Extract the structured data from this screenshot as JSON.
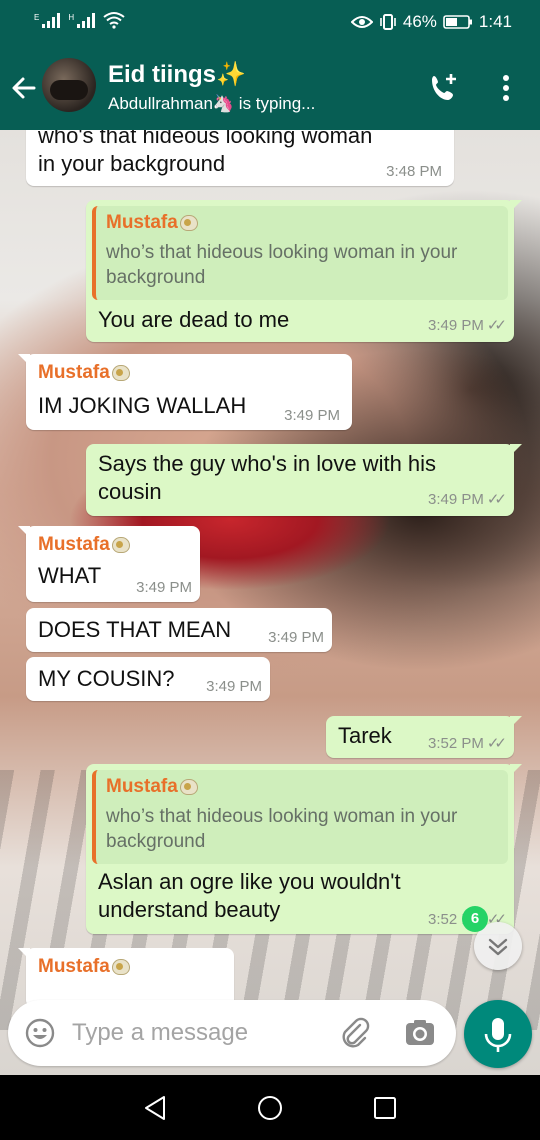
{
  "status_bar": {
    "sim1": "E",
    "sim2": "H",
    "battery": "46%",
    "time": "1:41"
  },
  "header": {
    "title": "Eid tiings✨",
    "subtitle": "Abdullrahman🦄 is typing..."
  },
  "messages": [
    {
      "text": "who's that hideous looking woman in your background",
      "time": "3:48 PM"
    },
    {
      "quote_sender": "Mustafa",
      "quote_text": "who’s that hideous looking woman in your background",
      "text": "You are dead to me",
      "time": "3:49 PM",
      "ticks": "✓✓"
    },
    {
      "sender": "Mustafa",
      "text": "IM JOKING WALLAH",
      "time": "3:49 PM"
    },
    {
      "text": "Says the guy who's in love with his cousin",
      "time": "3:49 PM",
      "ticks": "✓✓"
    },
    {
      "sender": "Mustafa",
      "text": "WHAT",
      "time": "3:49 PM"
    },
    {
      "text": "DOES THAT MEAN",
      "time": "3:49 PM"
    },
    {
      "text": "MY COUSIN?",
      "time": "3:49 PM"
    },
    {
      "text": "Tarek",
      "time": "3:52 PM",
      "ticks": "✓✓"
    },
    {
      "quote_sender": "Mustafa",
      "quote_text": "who’s that hideous looking woman in your background",
      "text": "Aslan an ogre like you wouldn't understand beauty",
      "time": "3:52 PM",
      "ticks": "✓✓"
    },
    {
      "sender": "Mustafa"
    }
  ],
  "unread_count": "6",
  "composer": {
    "placeholder": "Type a message"
  },
  "colors": {
    "header": "#075e54",
    "outgoing_bubble": "#dcf8c6",
    "incoming_bubble": "#ffffff",
    "sender_name": "#e8702a",
    "mic_button": "#00897b",
    "badge": "#25d366"
  }
}
